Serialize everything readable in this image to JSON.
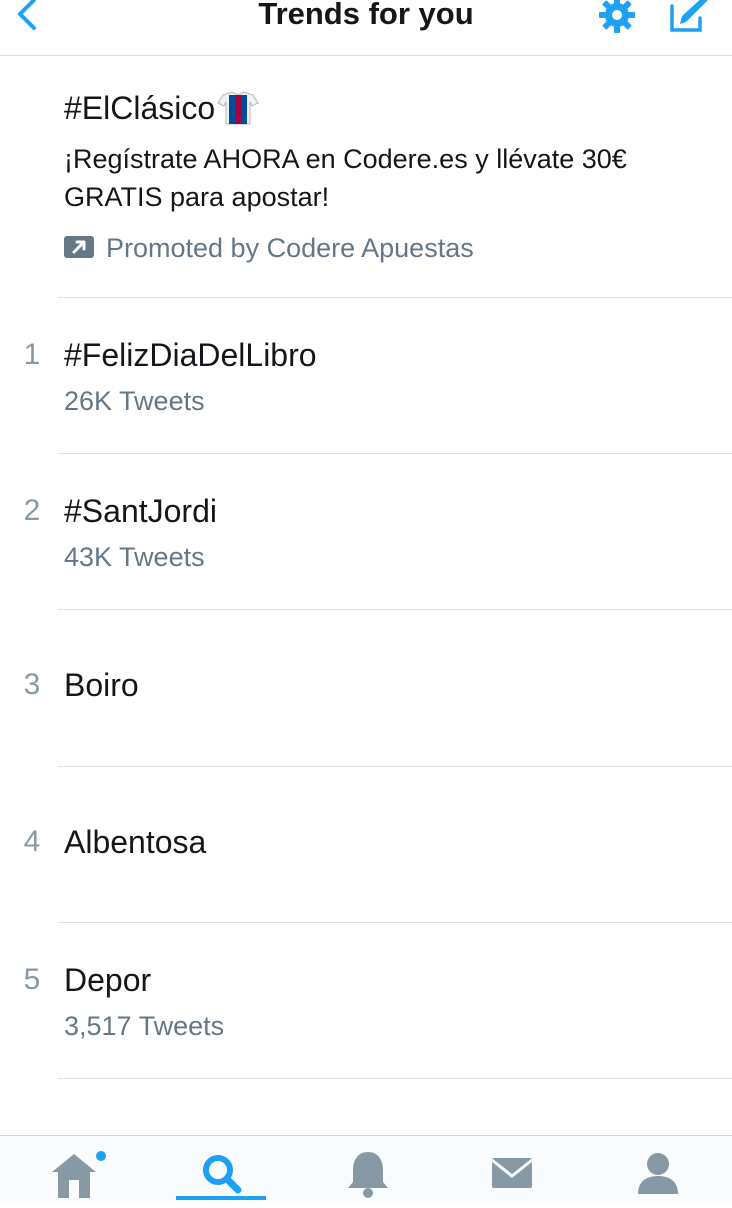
{
  "header": {
    "title": "Trends for you",
    "back_icon": "chevron-left-icon",
    "settings_icon": "gear-icon",
    "compose_icon": "compose-icon",
    "accent_color": "#1da1f2"
  },
  "promoted_trend": {
    "hashtag": "#ElClásico",
    "emoji_icon": "jersey-icon",
    "description": "¡Regístrate AHORA en Codere.es y llévate 30€ GRATIS para apostar!",
    "promoted_label": "Promoted by Codere Apuestas",
    "promoted_icon": "promoted-arrow-icon"
  },
  "trends": [
    {
      "rank": "1",
      "name": "#FelizDiaDelLibro",
      "tweets": "26K Tweets"
    },
    {
      "rank": "2",
      "name": "#SantJordi",
      "tweets": "43K Tweets"
    },
    {
      "rank": "3",
      "name": "Boiro",
      "tweets": ""
    },
    {
      "rank": "4",
      "name": "Albentosa",
      "tweets": ""
    },
    {
      "rank": "5",
      "name": "Depor",
      "tweets": "3,517 Tweets"
    }
  ],
  "tabbar": {
    "tabs": [
      {
        "icon": "home-icon",
        "active": false,
        "has_dot": true
      },
      {
        "icon": "search-icon",
        "active": true,
        "has_dot": false
      },
      {
        "icon": "bell-icon",
        "active": false,
        "has_dot": false
      },
      {
        "icon": "mail-icon",
        "active": false,
        "has_dot": false
      },
      {
        "icon": "profile-icon",
        "active": false,
        "has_dot": false
      }
    ]
  },
  "colors": {
    "primary_text": "#14171a",
    "secondary_text": "#657786",
    "rank_text": "#8899a6",
    "divider": "#dfe3e7",
    "tab_icon": "#8899a6"
  }
}
